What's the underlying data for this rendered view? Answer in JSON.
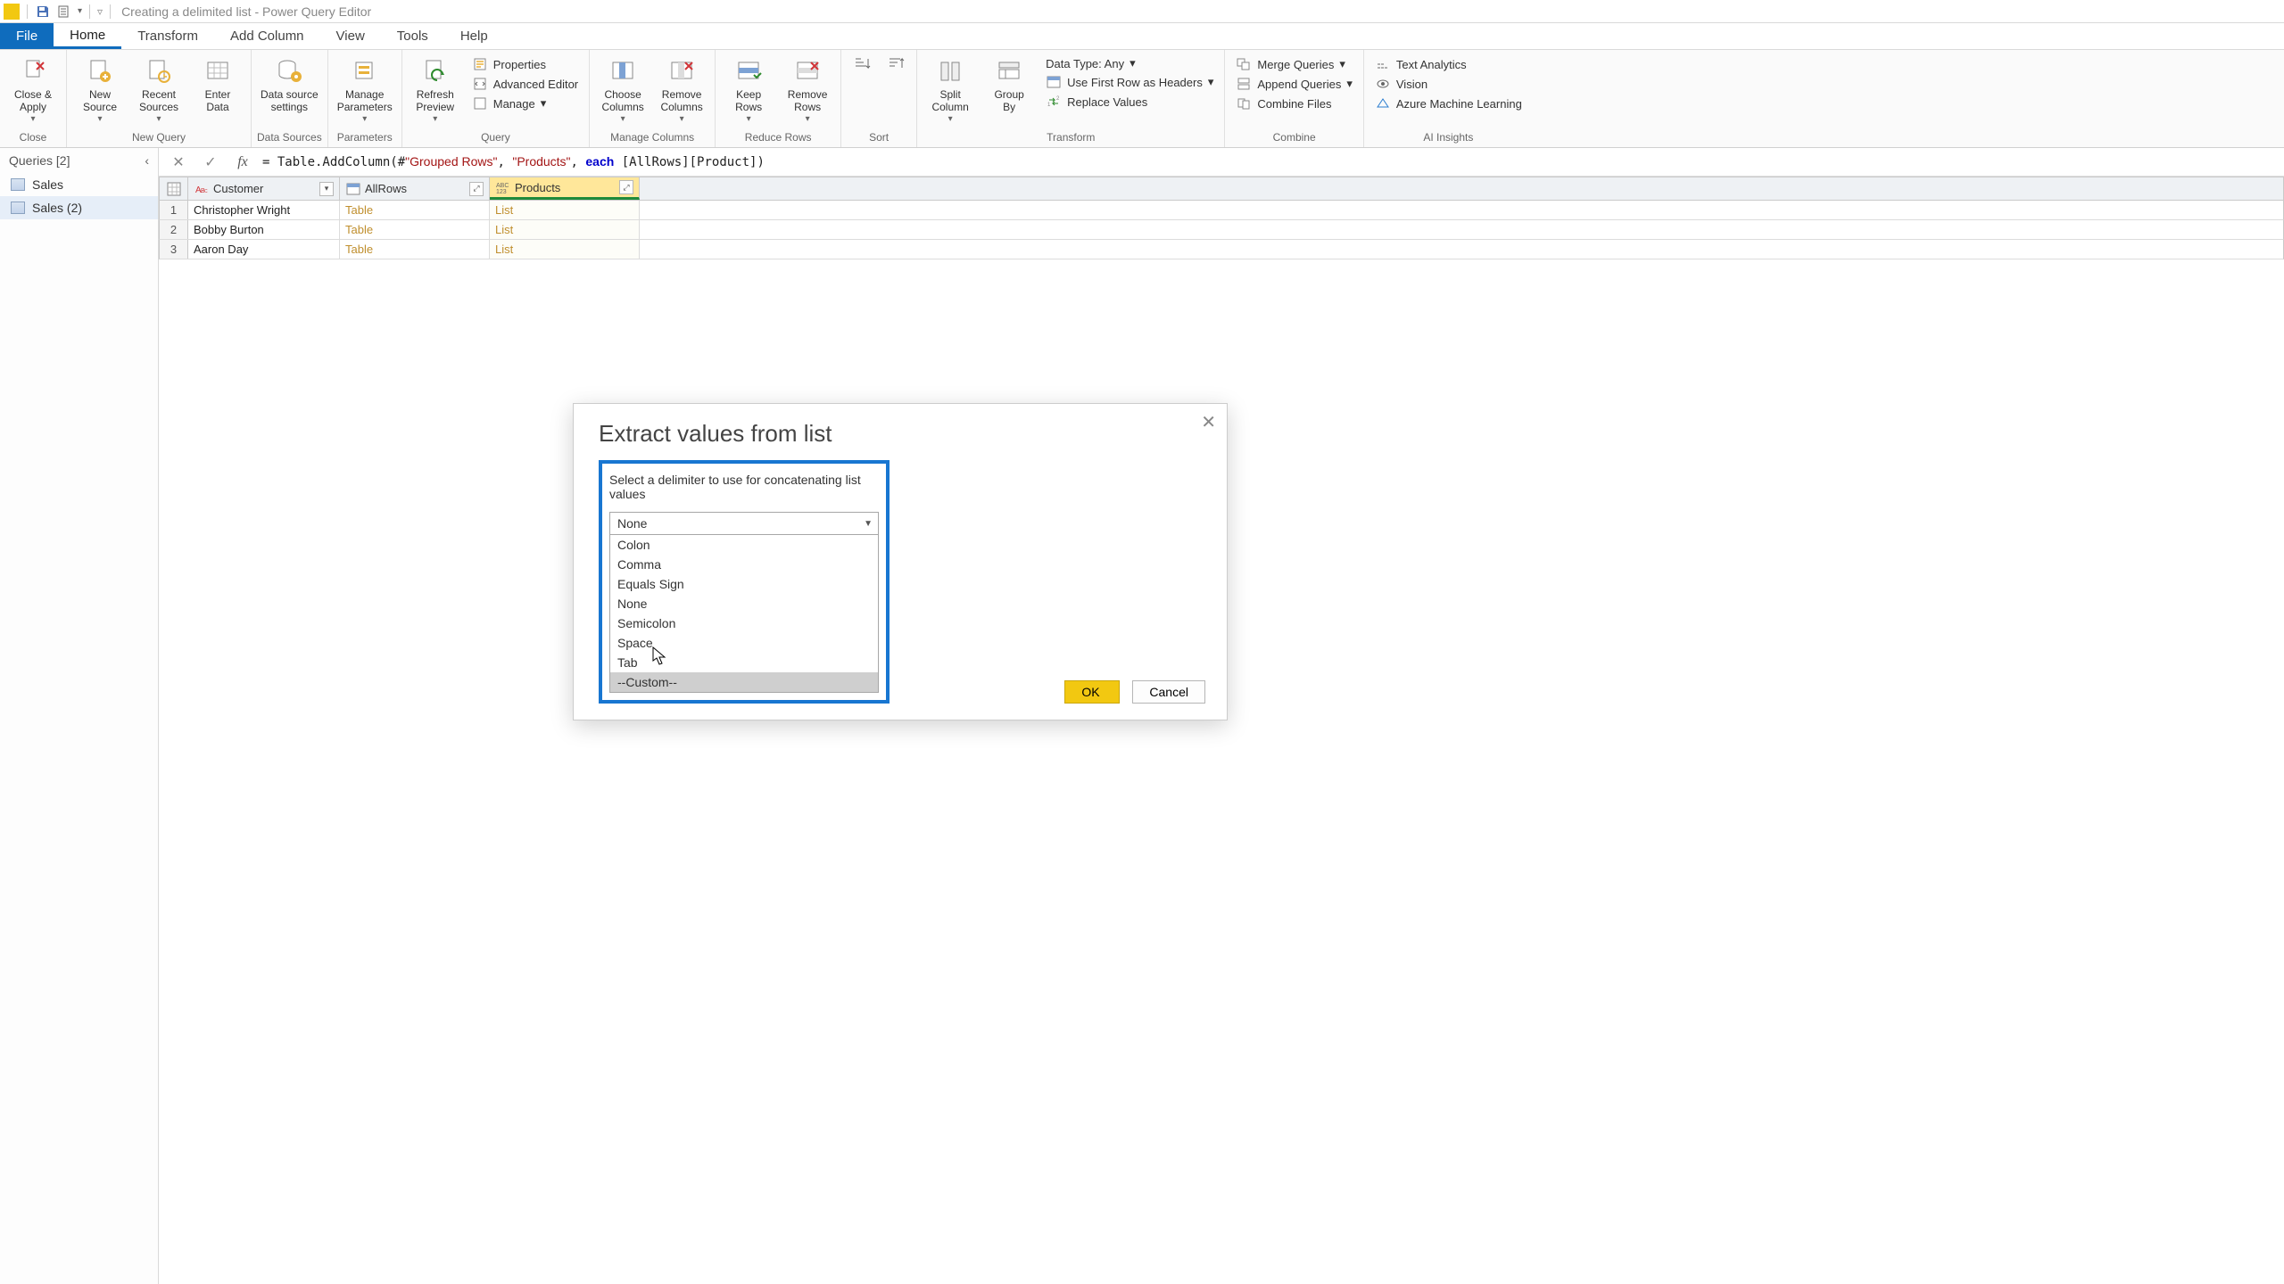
{
  "title": "Creating a delimited list - Power Query Editor",
  "menu": {
    "file": "File",
    "home": "Home",
    "transform": "Transform",
    "addcol": "Add Column",
    "view": "View",
    "tools": "Tools",
    "help": "Help"
  },
  "ribbon": {
    "close": {
      "label": "Close &\nApply",
      "group": "Close"
    },
    "newsource": "New\nSource",
    "recent": "Recent\nSources",
    "enterdata": "Enter\nData",
    "newquery_group": "New Query",
    "dssettings": "Data source\nsettings",
    "ds_group": "Data Sources",
    "params": "Manage\nParameters",
    "params_group": "Parameters",
    "refresh": "Refresh\nPreview",
    "properties": "Properties",
    "adveditor": "Advanced Editor",
    "manage": "Manage",
    "query_group": "Query",
    "choosecols": "Choose\nColumns",
    "removecols": "Remove\nColumns",
    "mc_group": "Manage Columns",
    "keeprows": "Keep\nRows",
    "removerows": "Remove\nRows",
    "rr_group": "Reduce Rows",
    "sort_group": "Sort",
    "splitcol": "Split\nColumn",
    "groupby": "Group\nBy",
    "datatype": "Data Type: Any",
    "firstrow": "Use First Row as Headers",
    "replace": "Replace Values",
    "trans_group": "Transform",
    "mergeq": "Merge Queries",
    "appendq": "Append Queries",
    "combinef": "Combine Files",
    "combine_group": "Combine",
    "textan": "Text Analytics",
    "vision": "Vision",
    "azureml": "Azure Machine Learning",
    "ai_group": "AI Insights"
  },
  "sidebar": {
    "header": "Queries [2]",
    "items": [
      "Sales",
      "Sales (2)"
    ]
  },
  "formula_plain": "= Table.AddColumn(#\"Grouped Rows\", \"Products\", each [AllRows][Product])",
  "columns": {
    "c1": "Customer",
    "c2": "AllRows",
    "c3": "Products"
  },
  "rows": [
    {
      "n": "1",
      "customer": "Christopher Wright",
      "allrows": "Table",
      "products": "List"
    },
    {
      "n": "2",
      "customer": "Bobby Burton",
      "allrows": "Table",
      "products": "List"
    },
    {
      "n": "3",
      "customer": "Aaron Day",
      "allrows": "Table",
      "products": "List"
    }
  ],
  "dialog": {
    "title": "Extract values from list",
    "prompt": "Select a delimiter to use for concatenating list values",
    "selected": "None",
    "options": [
      "Colon",
      "Comma",
      "Equals Sign",
      "None",
      "Semicolon",
      "Space",
      "Tab",
      "--Custom--"
    ],
    "ok": "OK",
    "cancel": "Cancel"
  }
}
